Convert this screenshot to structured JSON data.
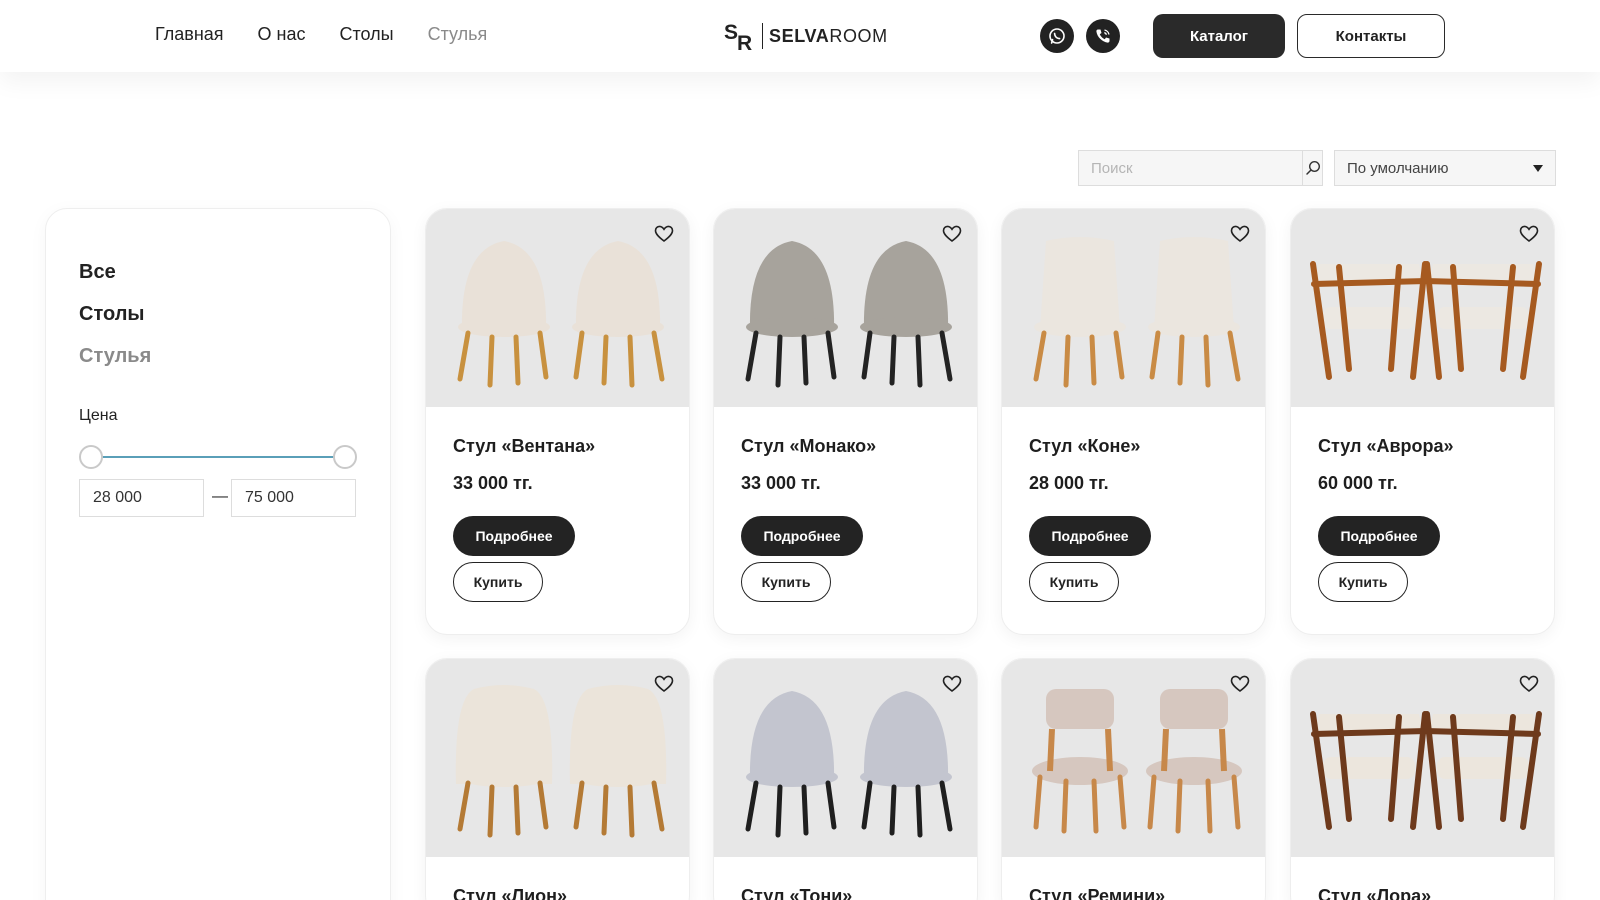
{
  "nav": [
    {
      "label": "Главная",
      "active": false
    },
    {
      "label": "О нас",
      "active": false
    },
    {
      "label": "Столы",
      "active": false
    },
    {
      "label": "Стулья",
      "active": true
    }
  ],
  "logo": {
    "mark": "SR",
    "bold": "SELVA",
    "light": "ROOM"
  },
  "header_icons": [
    "whatsapp-icon",
    "phone-icon"
  ],
  "buttons": {
    "catalog": "Каталог",
    "contacts": "Контакты"
  },
  "search": {
    "placeholder": "Поиск",
    "value": ""
  },
  "sort": {
    "selected": "По умолчанию"
  },
  "sidebar": {
    "categories": [
      {
        "label": "Все",
        "active": false
      },
      {
        "label": "Столы",
        "active": false
      },
      {
        "label": "Стулья",
        "active": true
      }
    ],
    "price_label": "Цена",
    "price_min": "28 000",
    "price_max": "75 000"
  },
  "card_buttons": {
    "more": "Подробнее",
    "buy": "Купить"
  },
  "products": [
    {
      "title": "Стул «Вентана»",
      "price": "33 000 тг.",
      "seat": "#e9e1d8",
      "legs": "#c8913f",
      "style": "round"
    },
    {
      "title": "Стул «Монако»",
      "price": "33 000 тг.",
      "seat": "#a7a39c",
      "legs": "#232323",
      "style": "round"
    },
    {
      "title": "Стул «Коне»",
      "price": "28 000 тг.",
      "seat": "#ebe6df",
      "legs": "#c98b45",
      "style": "square"
    },
    {
      "title": "Стул «Аврора»",
      "price": "60 000 тг.",
      "seat": "#ece8e2",
      "legs": "#a65a20",
      "style": "arm"
    },
    {
      "title": "Стул «Лион»",
      "price": "",
      "seat": "#ebe4da",
      "legs": "#b47a35",
      "style": "tub"
    },
    {
      "title": "Стул «Тони»",
      "price": "",
      "seat": "#c3c5cf",
      "legs": "#1f1f1f",
      "style": "round"
    },
    {
      "title": "Стул «Ремини»",
      "price": "",
      "seat": "#d6c7bf",
      "legs": "#c7884a",
      "style": "low"
    },
    {
      "title": "Стул «Лора»",
      "price": "",
      "seat": "#ece6dd",
      "legs": "#6e3a1c",
      "style": "arm"
    }
  ]
}
